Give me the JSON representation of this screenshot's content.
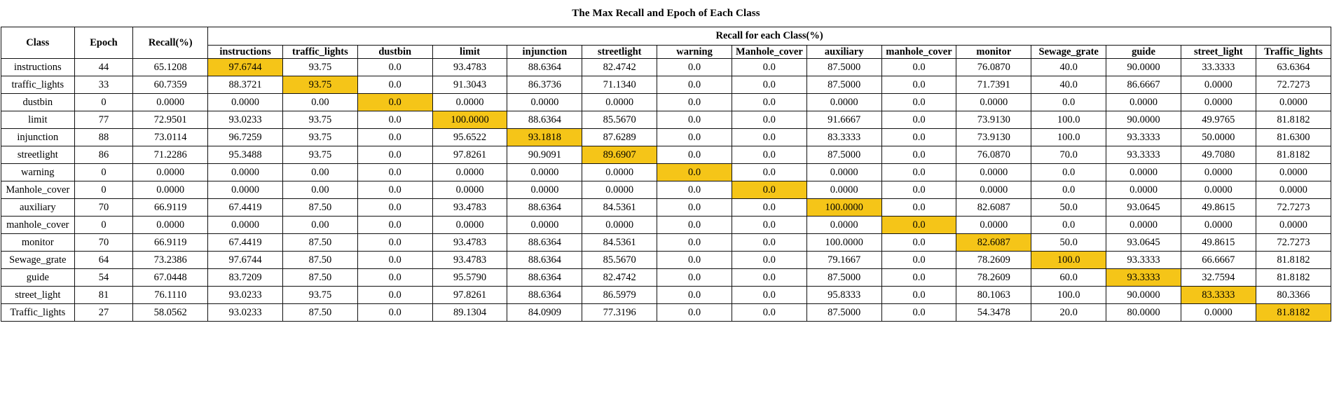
{
  "title": "The Max Recall and Epoch of Each Class",
  "header": {
    "class_label": "Class",
    "epoch_label": "Epoch",
    "recall_label": "Recall(%)",
    "group_label": "Recall for each Class(%)",
    "class_columns": [
      "instructions",
      "traffic_lights",
      "dustbin",
      "limit",
      "injunction",
      "streetlight",
      "warning",
      "Manhole_cover",
      "auxiliary",
      "manhole_cover",
      "monitor",
      "Sewage_grate",
      "guide",
      "street_light",
      "Traffic_lights"
    ]
  },
  "highlight_color": "#F5C518",
  "chart_data": {
    "type": "table",
    "title": "The Max Recall and Epoch of Each Class",
    "columns": [
      "Class",
      "Epoch",
      "Recall(%)",
      "instructions",
      "traffic_lights",
      "dustbin",
      "limit",
      "injunction",
      "streetlight",
      "warning",
      "Manhole_cover",
      "auxiliary",
      "manhole_cover",
      "monitor",
      "Sewage_grate",
      "guide",
      "street_light",
      "Traffic_lights"
    ],
    "rows": [
      {
        "class": "instructions",
        "epoch": "44",
        "recall": "65.1208",
        "highlight": 0,
        "values": [
          "97.6744",
          "93.75",
          "0.0",
          "93.4783",
          "88.6364",
          "82.4742",
          "0.0",
          "0.0",
          "87.5000",
          "0.0",
          "76.0870",
          "40.0",
          "90.0000",
          "33.3333",
          "63.6364"
        ]
      },
      {
        "class": "traffic_lights",
        "epoch": "33",
        "recall": "60.7359",
        "highlight": 1,
        "values": [
          "88.3721",
          "93.75",
          "0.0",
          "91.3043",
          "86.3736",
          "71.1340",
          "0.0",
          "0.0",
          "87.5000",
          "0.0",
          "71.7391",
          "40.0",
          "86.6667",
          "0.0000",
          "72.7273"
        ]
      },
      {
        "class": "dustbin",
        "epoch": "0",
        "recall": "0.0000",
        "highlight": 2,
        "values": [
          "0.0000",
          "0.00",
          "0.0",
          "0.0000",
          "0.0000",
          "0.0000",
          "0.0",
          "0.0",
          "0.0000",
          "0.0",
          "0.0000",
          "0.0",
          "0.0000",
          "0.0000",
          "0.0000"
        ]
      },
      {
        "class": "limit",
        "epoch": "77",
        "recall": "72.9501",
        "highlight": 3,
        "values": [
          "93.0233",
          "93.75",
          "0.0",
          "100.0000",
          "88.6364",
          "85.5670",
          "0.0",
          "0.0",
          "91.6667",
          "0.0",
          "73.9130",
          "100.0",
          "90.0000",
          "49.9765",
          "81.8182"
        ]
      },
      {
        "class": "injunction",
        "epoch": "88",
        "recall": "73.0114",
        "highlight": 4,
        "values": [
          "96.7259",
          "93.75",
          "0.0",
          "95.6522",
          "93.1818",
          "87.6289",
          "0.0",
          "0.0",
          "83.3333",
          "0.0",
          "73.9130",
          "100.0",
          "93.3333",
          "50.0000",
          "81.6300"
        ]
      },
      {
        "class": "streetlight",
        "epoch": "86",
        "recall": "71.2286",
        "highlight": 5,
        "values": [
          "95.3488",
          "93.75",
          "0.0",
          "97.8261",
          "90.9091",
          "89.6907",
          "0.0",
          "0.0",
          "87.5000",
          "0.0",
          "76.0870",
          "70.0",
          "93.3333",
          "49.7080",
          "81.8182"
        ]
      },
      {
        "class": "warning",
        "epoch": "0",
        "recall": "0.0000",
        "highlight": 6,
        "values": [
          "0.0000",
          "0.00",
          "0.0",
          "0.0000",
          "0.0000",
          "0.0000",
          "0.0",
          "0.0",
          "0.0000",
          "0.0",
          "0.0000",
          "0.0",
          "0.0000",
          "0.0000",
          "0.0000"
        ]
      },
      {
        "class": "Manhole_cover",
        "epoch": "0",
        "recall": "0.0000",
        "highlight": 7,
        "values": [
          "0.0000",
          "0.00",
          "0.0",
          "0.0000",
          "0.0000",
          "0.0000",
          "0.0",
          "0.0",
          "0.0000",
          "0.0",
          "0.0000",
          "0.0",
          "0.0000",
          "0.0000",
          "0.0000"
        ]
      },
      {
        "class": "auxiliary",
        "epoch": "70",
        "recall": "66.9119",
        "highlight": 8,
        "values": [
          "67.4419",
          "87.50",
          "0.0",
          "93.4783",
          "88.6364",
          "84.5361",
          "0.0",
          "0.0",
          "100.0000",
          "0.0",
          "82.6087",
          "50.0",
          "93.0645",
          "49.8615",
          "72.7273"
        ]
      },
      {
        "class": "manhole_cover",
        "epoch": "0",
        "recall": "0.0000",
        "highlight": 9,
        "values": [
          "0.0000",
          "0.00",
          "0.0",
          "0.0000",
          "0.0000",
          "0.0000",
          "0.0",
          "0.0",
          "0.0000",
          "0.0",
          "0.0000",
          "0.0",
          "0.0000",
          "0.0000",
          "0.0000"
        ]
      },
      {
        "class": "monitor",
        "epoch": "70",
        "recall": "66.9119",
        "highlight": 10,
        "values": [
          "67.4419",
          "87.50",
          "0.0",
          "93.4783",
          "88.6364",
          "84.5361",
          "0.0",
          "0.0",
          "100.0000",
          "0.0",
          "82.6087",
          "50.0",
          "93.0645",
          "49.8615",
          "72.7273"
        ]
      },
      {
        "class": "Sewage_grate",
        "epoch": "64",
        "recall": "73.2386",
        "highlight": 11,
        "values": [
          "97.6744",
          "87.50",
          "0.0",
          "93.4783",
          "88.6364",
          "85.5670",
          "0.0",
          "0.0",
          "79.1667",
          "0.0",
          "78.2609",
          "100.0",
          "93.3333",
          "66.6667",
          "81.8182"
        ]
      },
      {
        "class": "guide",
        "epoch": "54",
        "recall": "67.0448",
        "highlight": 12,
        "values": [
          "83.7209",
          "87.50",
          "0.0",
          "95.5790",
          "88.6364",
          "82.4742",
          "0.0",
          "0.0",
          "87.5000",
          "0.0",
          "78.2609",
          "60.0",
          "93.3333",
          "32.7594",
          "81.8182"
        ]
      },
      {
        "class": "street_light",
        "epoch": "81",
        "recall": "76.1110",
        "highlight": 13,
        "values": [
          "93.0233",
          "93.75",
          "0.0",
          "97.8261",
          "88.6364",
          "86.5979",
          "0.0",
          "0.0",
          "95.8333",
          "0.0",
          "80.1063",
          "100.0",
          "90.0000",
          "83.3333",
          "80.3366"
        ]
      },
      {
        "class": "Traffic_lights",
        "epoch": "27",
        "recall": "58.0562",
        "highlight": 14,
        "values": [
          "93.0233",
          "87.50",
          "0.0",
          "89.1304",
          "84.0909",
          "77.3196",
          "0.0",
          "0.0",
          "87.5000",
          "0.0",
          "54.3478",
          "20.0",
          "80.0000",
          "0.0000",
          "81.8182"
        ]
      }
    ]
  }
}
